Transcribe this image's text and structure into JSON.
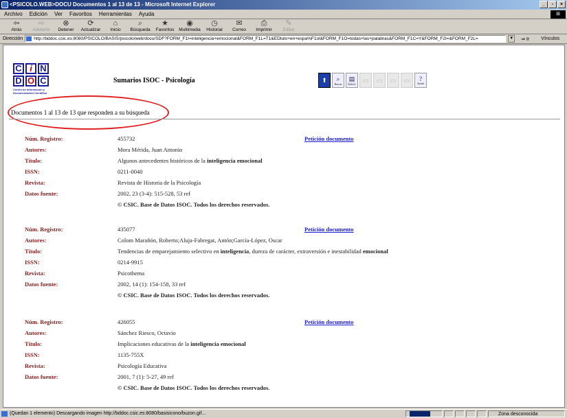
{
  "window": {
    "title": "<PSICOLO.WEB>DOCU Documentos 1 al 13 de 13 - Microsoft Internet Explorer"
  },
  "menu": [
    "Archivo",
    "Edición",
    "Ver",
    "Favoritos",
    "Herramientas",
    "Ayuda"
  ],
  "toolbar": [
    {
      "label": "Atrás",
      "icon": "back-arrow-icon",
      "glyph": "⇦",
      "enabled": true
    },
    {
      "label": "Adelante",
      "icon": "forward-arrow-icon",
      "glyph": "⇨",
      "enabled": false
    },
    {
      "label": "Detener",
      "icon": "stop-icon",
      "glyph": "⊗",
      "enabled": true
    },
    {
      "label": "Actualizar",
      "icon": "refresh-icon",
      "glyph": "⟳",
      "enabled": true
    },
    {
      "label": "Inicio",
      "icon": "home-icon",
      "glyph": "⌂",
      "enabled": true
    },
    {
      "label": "Búsqueda",
      "icon": "search-icon",
      "glyph": "⌕",
      "enabled": true
    },
    {
      "label": "Favoritos",
      "icon": "favorites-icon",
      "glyph": "★",
      "enabled": true
    },
    {
      "label": "Multimedia",
      "icon": "media-icon",
      "glyph": "◉",
      "enabled": true
    },
    {
      "label": "Historial",
      "icon": "history-icon",
      "glyph": "◷",
      "enabled": true
    },
    {
      "label": "Correo",
      "icon": "mail-icon",
      "glyph": "✉",
      "enabled": true
    },
    {
      "label": "Imprimir",
      "icon": "print-icon",
      "glyph": "⎙",
      "enabled": true
    },
    {
      "label": "Editar",
      "icon": "edit-icon",
      "glyph": "✎",
      "enabled": false
    }
  ],
  "address": {
    "label": "Dirección",
    "url": "http://bddoc.csic.es:8080/PSICOLO/BASIS/psicolo/web/docu/SDF?FORM_F1I=inteligencia+emocional&FORM_F1L=T1&EDtulo+en+espa%F1ol&FORM_F1O=todas+las+palabras&FORM_F1C=Y&FORM_F2I=&FORM_F2L=",
    "go": "Ir",
    "links": "Vínculos"
  },
  "header": {
    "logo_letters_top": [
      "C",
      "i",
      "N"
    ],
    "logo_letters_bottom": [
      "D",
      "O",
      "C"
    ],
    "logo_sub": "Centro de Información y Documentación Científica",
    "title": "Sumarios ISOC - Psicología"
  },
  "iconbar": [
    {
      "name": "top-icon",
      "glyph": "⬆",
      "label": "",
      "state": "active"
    },
    {
      "name": "search-icon",
      "glyph": "⌕",
      "label": "Buscar",
      "state": "enabled"
    },
    {
      "name": "index-icon",
      "glyph": "▤",
      "label": "Índices",
      "state": "enabled"
    },
    {
      "name": "first-icon",
      "glyph": "▭",
      "label": "",
      "state": "disabled"
    },
    {
      "name": "prev-icon",
      "glyph": "▭",
      "label": "",
      "state": "disabled"
    },
    {
      "name": "next-icon",
      "glyph": "▭",
      "label": "",
      "state": "disabled"
    },
    {
      "name": "last-icon",
      "glyph": "▭",
      "label": "",
      "state": "disabled"
    },
    {
      "name": "help-icon",
      "glyph": "?",
      "label": "Ayuda",
      "state": "enabled"
    }
  ],
  "results_summary": "Documentos 1 al 13 de 13 que responden a su búsqueda",
  "labels": {
    "registro": "Núm. Registro:",
    "autores": "Autores:",
    "titulo": "Título:",
    "issn": "ISSN:",
    "revista": "Revista:",
    "fuente": "Datos fuente:",
    "peticion": "Petición documento",
    "copyright": "© CSIC. Base de Datos ISOC. Todos los derechos reservados."
  },
  "records": [
    {
      "registro": "455732",
      "autores": "Mora Mérida, Juan Antonio",
      "titulo_parts": [
        {
          "t": "Algunos antecedentes históricos de la ",
          "b": false
        },
        {
          "t": "inteligencia emocional",
          "b": true
        }
      ],
      "issn": "0211-0040",
      "revista": "Revista de Historia de la Psicología",
      "fuente": "2002, 23 (3-4): 515-528, 53 ref"
    },
    {
      "registro": "435077",
      "autores": "Colom Marañón, Roberto;Aluja-Fabregat, Antón;García-López, Oscar",
      "titulo_parts": [
        {
          "t": "Tendencias de emparejamiento selectivo en ",
          "b": false
        },
        {
          "t": "inteligencia",
          "b": true
        },
        {
          "t": ", dureza de carácter, extraversión e inestabilidad ",
          "b": false
        },
        {
          "t": "emocional",
          "b": true
        }
      ],
      "issn": "0214-9915",
      "revista": "Psicothema",
      "fuente": "2002, 14 (1): 154-158, 33 ref"
    },
    {
      "registro": "426055",
      "autores": "Sánchez Riesco, Octavio",
      "titulo_parts": [
        {
          "t": "Implicaciones educativas de la ",
          "b": false
        },
        {
          "t": "inteligencia emocional",
          "b": true
        }
      ],
      "issn": "1135-755X",
      "revista": "Psicología Educativa",
      "fuente": "2001, 7 (1): 5-27, 49 ref"
    }
  ],
  "status": {
    "text": "(Quedan 1 elemento) Descargando imagen http://bddoc.csic.es:8080/basisicono/buzon.gif...",
    "zone": "Zona desconocida"
  }
}
